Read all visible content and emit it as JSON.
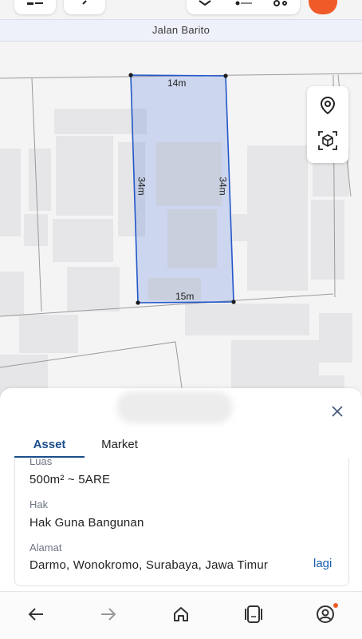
{
  "map": {
    "road_name": "Jalan Barito",
    "polygon_color": "#3e6fd6",
    "dimensions": {
      "top": "14m",
      "left": "34m",
      "right": "34m",
      "bottom": "15m"
    },
    "tools": [
      {
        "icon": "location-pin-icon"
      },
      {
        "icon": "3d-box-icon"
      }
    ]
  },
  "header": {
    "icons": [
      "menu-icon",
      "back-arrow-icon",
      "layers-icon",
      "filter-sliders-icon",
      "settings-icon",
      "profile-avatar-icon"
    ]
  },
  "sheet": {
    "tabs": [
      {
        "label": "Asset",
        "active": true
      },
      {
        "label": "Market",
        "active": false
      }
    ],
    "fields": {
      "luas": {
        "label": "Luas",
        "value": "500m² ~ 5ARE"
      },
      "hak": {
        "label": "Hak",
        "value": "Hak Guna Bangunan"
      },
      "alamat": {
        "label": "Alamat",
        "value": "Darmo, Wonokromo, Surabaya, Jawa Timur",
        "more": "lagi"
      }
    },
    "accent_color": "#1a4e8c"
  },
  "bottom_nav": {
    "items": [
      "back-icon",
      "forward-icon",
      "home-icon",
      "tabs-icon",
      "account-icon"
    ]
  }
}
